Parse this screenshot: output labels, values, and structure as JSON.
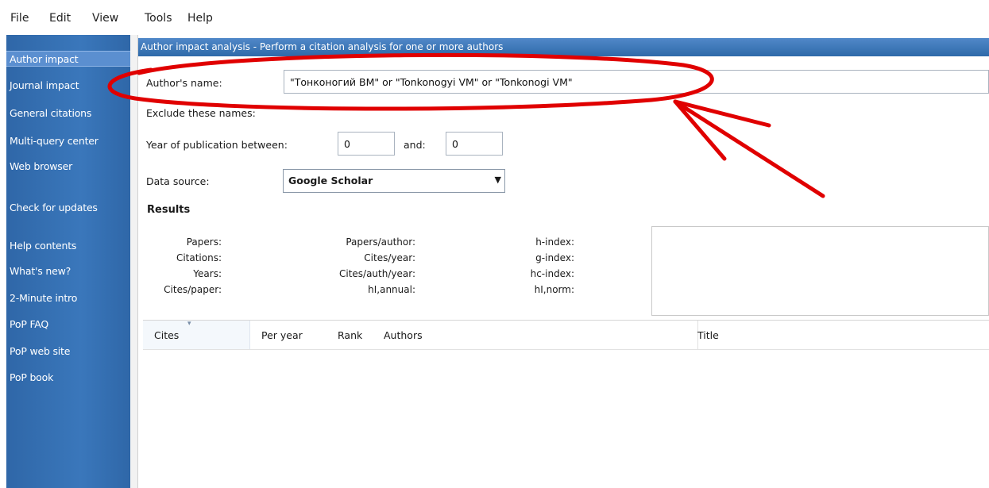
{
  "menu": [
    "File",
    "Edit",
    "View",
    "Tools",
    "Help"
  ],
  "sidebar": {
    "items": [
      {
        "label": "Author impact",
        "active": true
      },
      {
        "label": "Journal impact"
      },
      {
        "label": "General citations"
      },
      {
        "label": "Multi-query center"
      },
      {
        "label": "Web browser"
      },
      {
        "label": "Check for updates"
      },
      {
        "label": "Help contents"
      },
      {
        "label": "What's new?"
      },
      {
        "label": "2-Minute intro"
      },
      {
        "label": "PoP FAQ"
      },
      {
        "label": "PoP web site"
      },
      {
        "label": "PoP book"
      }
    ]
  },
  "header": {
    "title": "Author impact analysis - Perform a citation analysis for one or more authors"
  },
  "form": {
    "author_label": "Author's name:",
    "author_value": "\"Тонконогий ВМ\" or \"Tonkonogyi VM\" or \"Tonkonogi VM\"",
    "exclude_label": "Exclude these names:",
    "year_label": "Year of publication between:",
    "year_from": "0",
    "and_label": "and:",
    "year_to": "0",
    "source_label": "Data source:",
    "source_value": "Google Scholar"
  },
  "results": {
    "title": "Results",
    "col1": [
      "Papers:",
      "Citations:",
      "Years:",
      "Cites/paper:"
    ],
    "col2": [
      "Papers/author:",
      "Cites/year:",
      "Cites/auth/year:",
      "hI,annual:"
    ],
    "col3": [
      "h-index:",
      "g-index:",
      "hc-index:",
      "hI,norm:"
    ]
  },
  "table": {
    "columns": [
      "Cites",
      "Per year",
      "Rank",
      "Authors",
      "Title"
    ]
  },
  "colors": {
    "sidebar": "#3a77bb",
    "header": "#3d78bb",
    "annotation": "#e00000"
  }
}
